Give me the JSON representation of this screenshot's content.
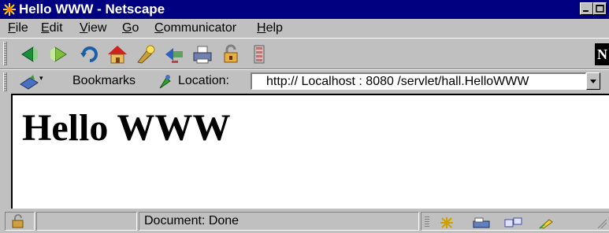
{
  "window": {
    "title": "Hello WWW - Netscape"
  },
  "menu": [
    {
      "label": "File"
    },
    {
      "label": "Edit"
    },
    {
      "label": "View"
    },
    {
      "label": "Go"
    },
    {
      "label": "Communicator"
    },
    {
      "label": "Help"
    }
  ],
  "toolbar": {
    "buttons": [
      "back-icon",
      "forward-icon",
      "reload-icon",
      "home-icon",
      "search-icon",
      "guide-icon",
      "print-icon",
      "security-icon",
      "stop-icon"
    ],
    "logo_text": "N"
  },
  "location_bar": {
    "bookmarks_label": "Bookmarks",
    "location_label": "Location:",
    "url": "http:// Localhost : 8080 /servlet/hall.HelloWWW"
  },
  "page": {
    "heading": "Hello WWW"
  },
  "status": {
    "text": "Document: Done"
  },
  "colors": {
    "title_bar": "#000080",
    "chrome": "#c0c0c0",
    "content_bg": "#ffffff"
  }
}
